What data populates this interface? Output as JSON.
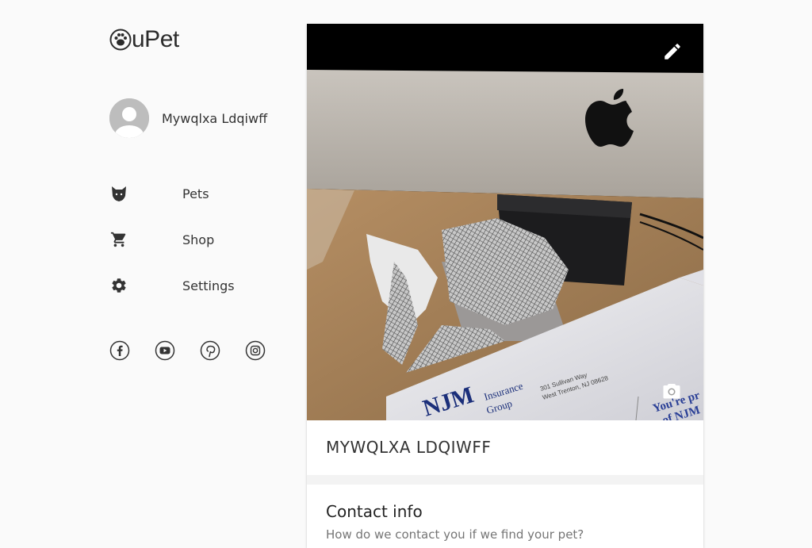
{
  "brand": {
    "name": "uPet"
  },
  "profile": {
    "name": "Mywqlxa Ldqiwff"
  },
  "nav": [
    {
      "label": "Pets",
      "icon": "pet-face-icon"
    },
    {
      "label": "Shop",
      "icon": "shopping-cart-icon"
    },
    {
      "label": "Settings",
      "icon": "gear-icon"
    }
  ],
  "socials": [
    "facebook-icon",
    "youtube-icon",
    "pinterest-icon",
    "instagram-icon"
  ],
  "pet_card": {
    "name": "MYWQLXA LDQIWFF",
    "photo_text": {
      "company": "Insurance\nGroup",
      "logo_partial": "NJM",
      "address_line1": "301 Sullivan Way",
      "address_line2": "West Trenton, NJ 08628",
      "slogan_partial": "You're pr",
      "slogan_partial2": "of NJM"
    },
    "contact": {
      "title": "Contact info",
      "subtitle": "How do we contact you if we find your pet?"
    }
  },
  "colors": {
    "background": "#fafafa",
    "card": "#ffffff",
    "text": "#333333",
    "muted": "#757575"
  }
}
